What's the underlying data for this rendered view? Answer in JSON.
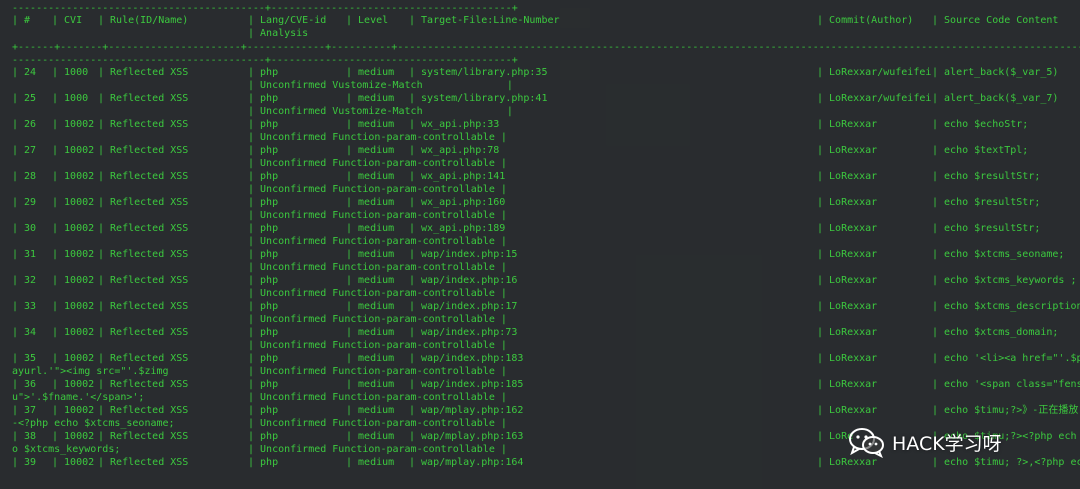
{
  "terminal": {
    "border_top": "------------------------------------------+----------------------------------------+",
    "header": {
      "cols": [
        "| #",
        "| CVI",
        "| Rule(ID/Name)",
        "| Lang/CVE-id",
        "| Level",
        "| Target-File:Line-Number",
        "| Commit(Author)",
        "| Source Code Content"
      ],
      "second": "| Analysis"
    },
    "sep_full": "+------+-------+----------------------+-------------+----------+---------------------------------------------------------------------------------------------------------------------------+---------------+------------------------------------",
    "border_mid": "------------------------------------------+----------------------------------------+",
    "rows": [
      {
        "n": "| 24",
        "cvi": "| 1000",
        "rule": "| Reflected XSS",
        "lang": "| php",
        "level": "| medium",
        "file": "| system/library.php:35",
        "commit": "| LoRexxar/wufeifei",
        "src": "| alert_back($_var_5)",
        "pre": "",
        "analysis": "| Unconfirmed Vustomize-Match              |"
      },
      {
        "n": "| 25",
        "cvi": "| 1000",
        "rule": "| Reflected XSS",
        "lang": "| php",
        "level": "| medium",
        "file": "| system/library.php:41",
        "commit": "| LoRexxar/wufeifei",
        "src": "| alert_back($_var_7)",
        "pre": "",
        "analysis": "| Unconfirmed Vustomize-Match              |"
      },
      {
        "n": "| 26",
        "cvi": "| 10002",
        "rule": "| Reflected XSS",
        "lang": "| php",
        "level": "| medium",
        "file": "| wx_api.php:33",
        "commit": "| LoRexxar",
        "src": "| echo $echoStr;",
        "pre": "",
        "analysis": "| Unconfirmed Function-param-controllable |"
      },
      {
        "n": "| 27",
        "cvi": "| 10002",
        "rule": "| Reflected XSS",
        "lang": "| php",
        "level": "| medium",
        "file": "| wx_api.php:78",
        "commit": "| LoRexxar",
        "src": "| echo $textTpl;",
        "pre": "",
        "analysis": "| Unconfirmed Function-param-controllable |"
      },
      {
        "n": "| 28",
        "cvi": "| 10002",
        "rule": "| Reflected XSS",
        "lang": "| php",
        "level": "| medium",
        "file": "| wx_api.php:141",
        "commit": "| LoRexxar",
        "src": "| echo $resultStr;",
        "pre": "",
        "analysis": "| Unconfirmed Function-param-controllable |"
      },
      {
        "n": "| 29",
        "cvi": "| 10002",
        "rule": "| Reflected XSS",
        "lang": "| php",
        "level": "| medium",
        "file": "| wx_api.php:160",
        "commit": "| LoRexxar",
        "src": "| echo $resultStr;",
        "pre": "",
        "analysis": "| Unconfirmed Function-param-controllable |"
      },
      {
        "n": "| 30",
        "cvi": "| 10002",
        "rule": "| Reflected XSS",
        "lang": "| php",
        "level": "| medium",
        "file": "| wx_api.php:189",
        "commit": "| LoRexxar",
        "src": "| echo $resultStr;",
        "pre": "",
        "analysis": "| Unconfirmed Function-param-controllable |"
      },
      {
        "n": "| 31",
        "cvi": "| 10002",
        "rule": "| Reflected XSS",
        "lang": "| php",
        "level": "| medium",
        "file": "| wap/index.php:15",
        "commit": "| LoRexxar",
        "src": "| echo $xtcms_seoname;",
        "pre": "",
        "analysis": "| Unconfirmed Function-param-controllable |"
      },
      {
        "n": "| 32",
        "cvi": "| 10002",
        "rule": "| Reflected XSS",
        "lang": "| php",
        "level": "| medium",
        "file": "| wap/index.php:16",
        "commit": "| LoRexxar",
        "src": "| echo $xtcms_keywords ;",
        "pre": "",
        "analysis": "| Unconfirmed Function-param-controllable |"
      },
      {
        "n": "| 33",
        "cvi": "| 10002",
        "rule": "| Reflected XSS",
        "lang": "| php",
        "level": "| medium",
        "file": "| wap/index.php:17",
        "commit": "| LoRexxar",
        "src": "| echo $xtcms_description;",
        "pre": "",
        "analysis": "| Unconfirmed Function-param-controllable |"
      },
      {
        "n": "| 34",
        "cvi": "| 10002",
        "rule": "| Reflected XSS",
        "lang": "| php",
        "level": "| medium",
        "file": "| wap/index.php:73",
        "commit": "| LoRexxar",
        "src": "| echo $xtcms_domain;",
        "pre": "",
        "analysis": "| Unconfirmed Function-param-controllable |"
      },
      {
        "n": "| 35",
        "cvi": "| 10002",
        "rule": "| Reflected XSS",
        "lang": "| php",
        "level": "| medium",
        "file": "| wap/index.php:183",
        "commit": "| LoRexxar",
        "src": "| echo '<li><a href=\"'.$pl",
        "pre": "ayurl.'\"><img src=\"'.$zimg",
        "analysis": "| Unconfirmed Function-param-controllable |"
      },
      {
        "n": "| 36",
        "cvi": "| 10002",
        "rule": "| Reflected XSS",
        "lang": "| php",
        "level": "| medium",
        "file": "| wap/index.php:185",
        "commit": "| LoRexxar",
        "src": "| echo '<span class=\"fensh",
        "pre": "u\">'.$fname.'</span>';",
        "analysis": "| Unconfirmed Function-param-controllable |"
      },
      {
        "n": "| 37",
        "cvi": "| 10002",
        "rule": "| Reflected XSS",
        "lang": "| php",
        "level": "| medium",
        "file": "| wap/mplay.php:162",
        "commit": "| LoRexxar",
        "src": "| echo $timu;?>》-正在播放",
        "pre": "-<?php echo $xtcms_seoname;",
        "analysis": "| Unconfirmed Function-param-controllable |"
      },
      {
        "n": "| 38",
        "cvi": "| 10002",
        "rule": "| Reflected XSS",
        "lang": "| php",
        "level": "| medium",
        "file": "| wap/mplay.php:163",
        "commit": "| LoRe",
        "src": "| echo $timu;?><?php ech",
        "pre": "o $xtcms_keywords;",
        "analysis": "| Unconfirmed Function-param-controllable |"
      },
      {
        "n": "| 39",
        "cvi": "| 10002",
        "rule": "| Reflected XSS",
        "lang": "| php",
        "level": "| medium",
        "file": "| wap/mplay.php:164",
        "commit": "| LoRexxar",
        "src": "| echo $timu; ?>,<?php ech",
        "pre": "",
        "analysis": ""
      }
    ]
  },
  "watermark": {
    "text": "HACK学习呀",
    "icon": "wechat-icon"
  },
  "colors": {
    "terminal_text": "#38c63c",
    "terminal_bg": "#24282a"
  }
}
